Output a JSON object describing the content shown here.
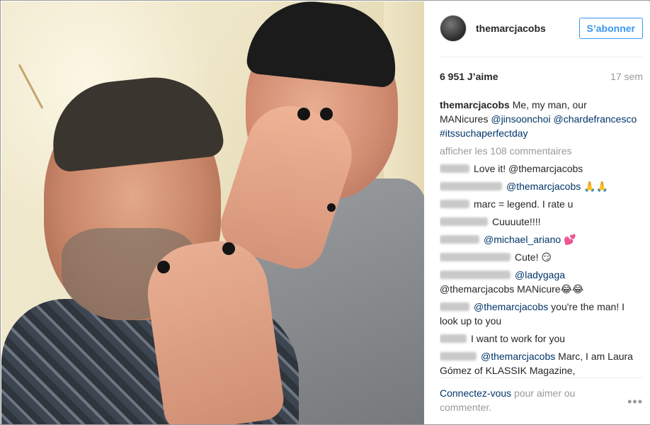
{
  "post": {
    "username": "themarcjacobs",
    "follow_label": "S’abonner",
    "likes": "6 951 J’aime",
    "time_ago": "17 sem"
  },
  "caption": {
    "user": "themarcjacobs",
    "text1": "Me, my man, our MANicures",
    "mention1": "@jinsoonchoi",
    "mention2": "@chardefrancesco",
    "hashtag": "#itssuchaperfectday"
  },
  "load_more": "afficher les 108 commentaires",
  "comments": [
    {
      "blur_width": 42,
      "text_link": "",
      "text": "Love it! @themarcjacobs"
    },
    {
      "blur_width": 88,
      "text_link": "@themarcjacobs",
      "text": " 🙏🙏"
    },
    {
      "blur_width": 42,
      "text_link": "",
      "text": "marc = legend. I rate u"
    },
    {
      "blur_width": 68,
      "text_link": "",
      "text": "Cuuuute!!!!"
    },
    {
      "blur_width": 56,
      "text_link": "@michael_ariano",
      "text": " 💕"
    },
    {
      "blur_width": 100,
      "text_link": "",
      "text": "Cute! 😏"
    },
    {
      "blur_width": 100,
      "text_link": "@ladygaga",
      "text": " @themarcjacobs MANicure😂😂"
    },
    {
      "blur_width": 42,
      "text_link": "@themarcjacobs",
      "text": " you're the man! I look up to you"
    },
    {
      "blur_width": 38,
      "text_link": "",
      "text": "I want to work for you"
    },
    {
      "blur_width": 52,
      "text_link": "@themarcjacobs",
      "text": " Marc, I am Laura Gómez of KLASSIK Magazine, www.klassikmagazine.com I would like to"
    }
  ],
  "footer": {
    "login": "Connectez-vous",
    "rest": " pour aimer ou commenter."
  },
  "more_icon": "ellipsis-icon"
}
